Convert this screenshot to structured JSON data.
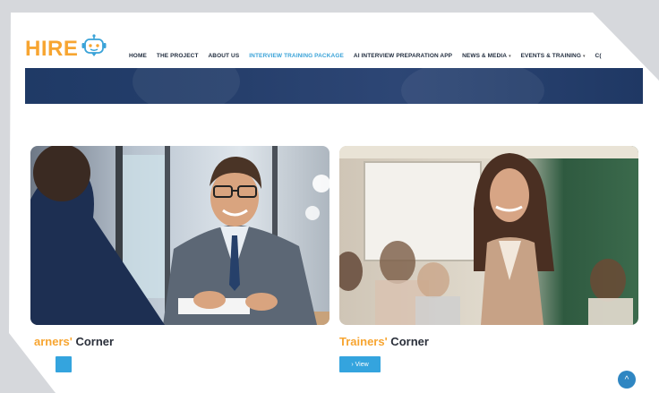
{
  "header": {
    "logo_text": "HIRE",
    "nav": [
      {
        "label": "HOME",
        "active": false
      },
      {
        "label": "THE PROJECT",
        "active": false
      },
      {
        "label": "ABOUT US",
        "active": false
      },
      {
        "label": "INTERVIEW TRAINING PACKAGE",
        "active": true
      },
      {
        "label": "AI INTERVIEW PREPARATION APP",
        "active": false
      },
      {
        "label": "NEWS & MEDIA",
        "active": false,
        "dropdown": true
      },
      {
        "label": "EVENTS & TRAINING",
        "active": false,
        "dropdown": true
      },
      {
        "label": "C(",
        "active": false
      }
    ]
  },
  "cards": {
    "left": {
      "title_highlight": "arners'",
      "title_rest": " Corner",
      "button_label": ""
    },
    "right": {
      "title_highlight": "Trainers'",
      "title_rest": " Corner",
      "button_label": "› View"
    }
  },
  "icons": {
    "logo": "robot-icon",
    "scroll_top": "chevron-up-icon"
  },
  "colors": {
    "accent_orange": "#f7a531",
    "accent_blue": "#34a4de",
    "hero_navy": "#1f3a66",
    "nav_active": "#3aa3d8"
  }
}
